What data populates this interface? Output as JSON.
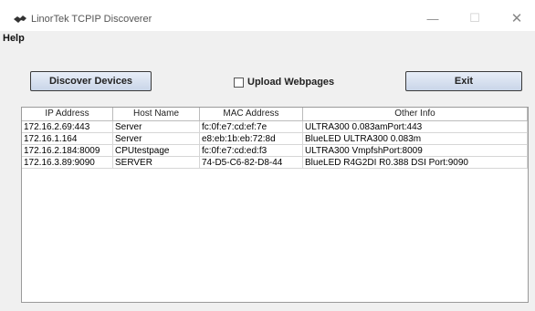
{
  "window": {
    "title": "LinorTek TCPIP Discoverer",
    "minimize_glyph": "—",
    "maximize_glyph": "☐",
    "close_glyph": "✕"
  },
  "menu": {
    "help": "Help"
  },
  "toolbar": {
    "discover_label": "Discover Devices",
    "upload_label": "Upload Webpages",
    "upload_checked": false,
    "exit_label": "Exit"
  },
  "table": {
    "headers": [
      "IP Address",
      "Host Name",
      "MAC Address",
      "Other Info"
    ],
    "rows": [
      [
        "172.16.2.69:443",
        "Server",
        "fc:0f:e7:cd:ef:7e",
        "ULTRA300 0.083amPort:443"
      ],
      [
        "172.16.1.164",
        "Server",
        "e8:eb:1b:eb:72:8d",
        "BlueLED ULTRA300 0.083m"
      ],
      [
        "172.16.2.184:8009",
        "CPUtestpage",
        "fc:0f:e7:cd:ed:f3",
        "ULTRA300 VmpfshPort:8009"
      ],
      [
        "172.16.3.89:9090",
        "SERVER",
        "74-D5-C6-82-D8-44",
        "BlueLED  R4G2DI R0.388 DSI Port:9090"
      ]
    ]
  },
  "icons": {
    "app": "app-logo-icon"
  }
}
